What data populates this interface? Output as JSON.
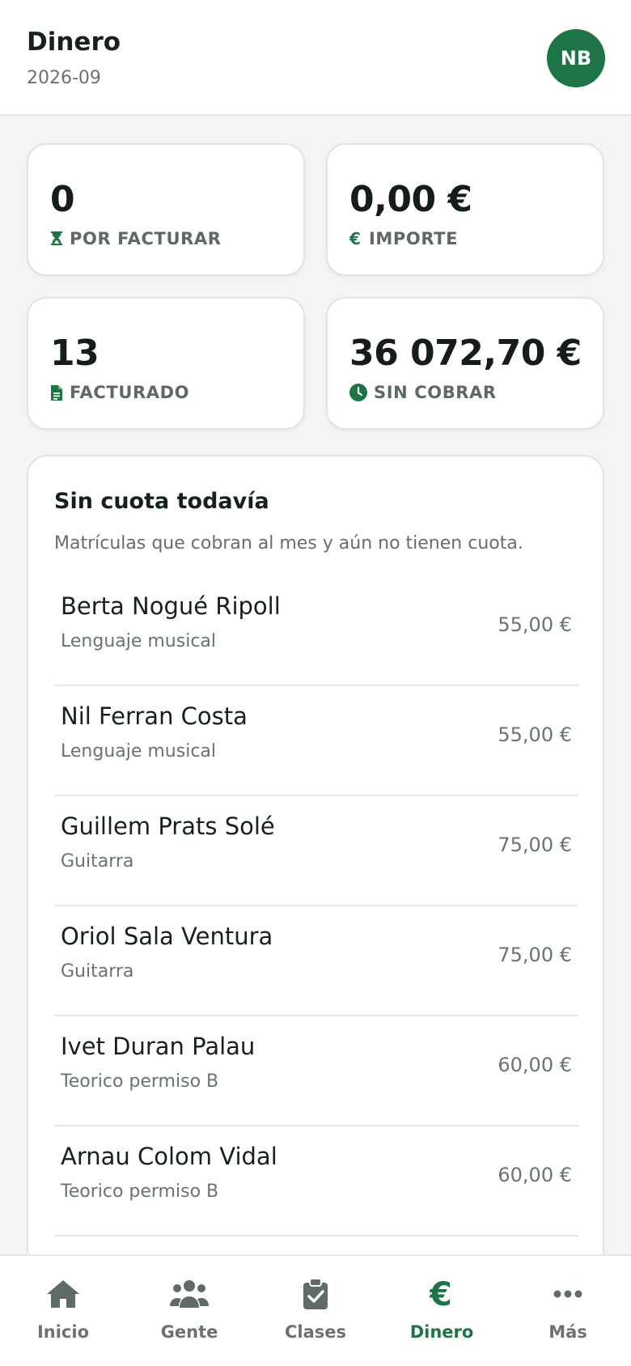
{
  "header": {
    "title": "Dinero",
    "subtitle": "2026-09",
    "avatar_initials": "NB"
  },
  "stats": [
    {
      "value": "0",
      "label": "POR FACTURAR",
      "icon": "hourglass-icon"
    },
    {
      "value": "0,00 €",
      "label": "IMPORTE",
      "icon": "euro-icon"
    },
    {
      "value": "13",
      "label": "FACTURADO",
      "icon": "document-icon"
    },
    {
      "value": "36 072,70 €",
      "label": "SIN COBRAR",
      "icon": "clock-icon"
    }
  ],
  "section": {
    "title": "Sin cuota todavía",
    "description": "Matrículas que cobran al mes y aún no tienen cuota.",
    "rows": [
      {
        "name": "Berta Nogué Ripoll",
        "course": "Lenguaje musical",
        "amount": "55,00 €"
      },
      {
        "name": "Nil Ferran Costa",
        "course": "Lenguaje musical",
        "amount": "55,00 €"
      },
      {
        "name": "Guillem Prats Solé",
        "course": "Guitarra",
        "amount": "75,00 €"
      },
      {
        "name": "Oriol Sala Ventura",
        "course": "Guitarra",
        "amount": "75,00 €"
      },
      {
        "name": "Ivet Duran Palau",
        "course": "Teorico permiso B",
        "amount": "60,00 €"
      },
      {
        "name": "Arnau Colom Vidal",
        "course": "Teorico permiso B",
        "amount": "60,00 €"
      }
    ]
  },
  "nav": {
    "items": [
      {
        "label": "Inicio",
        "icon": "home-icon"
      },
      {
        "label": "Gente",
        "icon": "people-icon"
      },
      {
        "label": "Clases",
        "icon": "clipboard-check-icon"
      },
      {
        "label": "Dinero",
        "icon": "euro-icon",
        "active": true
      },
      {
        "label": "Más",
        "icon": "more-icon"
      }
    ]
  },
  "colors": {
    "accent": "#1c7447",
    "text": "#17211c",
    "muted": "#6a746f",
    "background": "#f3f4f3"
  }
}
